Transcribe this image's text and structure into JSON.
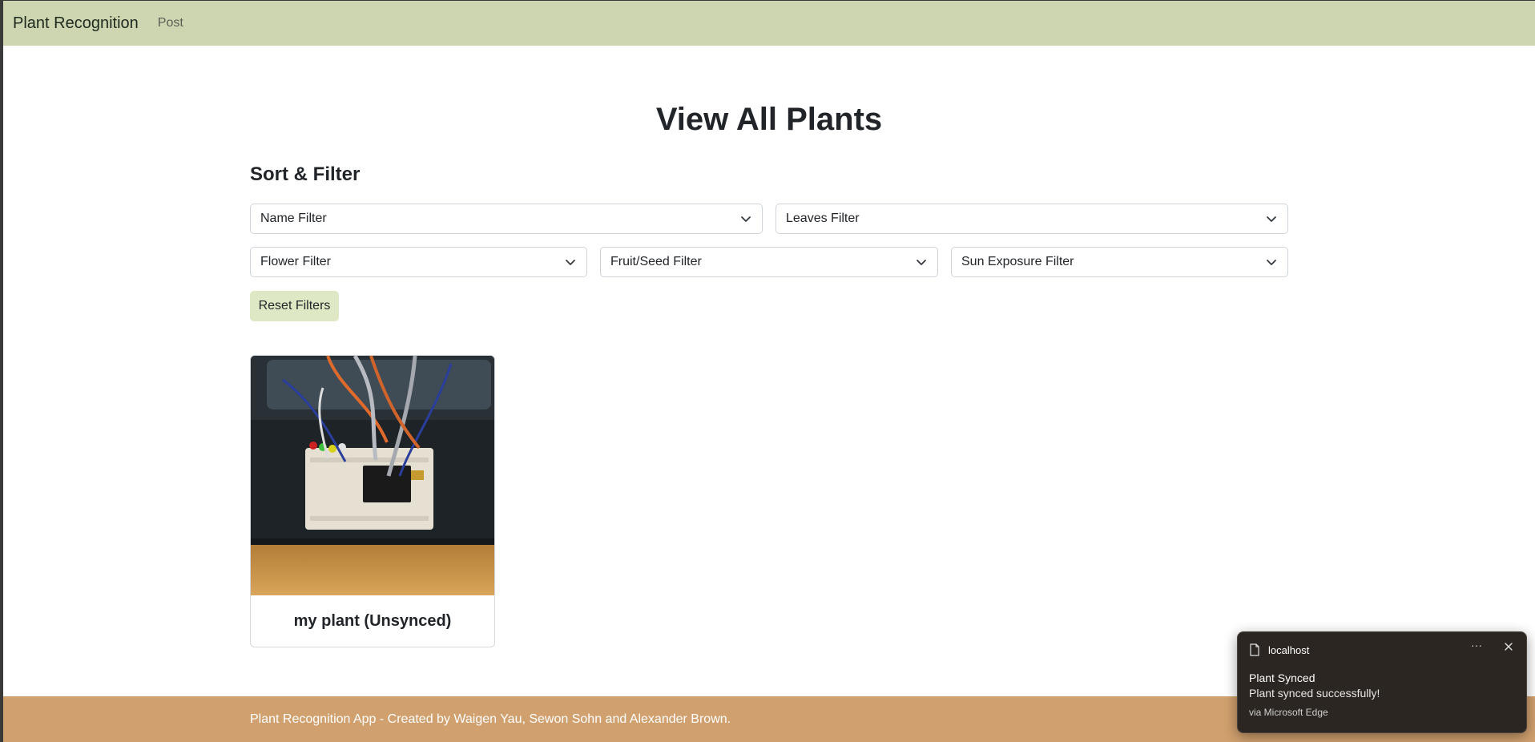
{
  "navbar": {
    "brand": "Plant Recognition",
    "post_link": "Post"
  },
  "page": {
    "title": "View All Plants"
  },
  "filters": {
    "section_title": "Sort & Filter",
    "name": "Name Filter",
    "leaves": "Leaves Filter",
    "flower": "Flower Filter",
    "fruit_seed": "Fruit/Seed Filter",
    "sun_exposure": "Sun Exposure Filter",
    "reset_label": "Reset Filters"
  },
  "plants": [
    {
      "title": "my plant (Unsynced)"
    }
  ],
  "footer": {
    "text": "Plant Recognition App - Created by Waigen Yau, Sewon Sohn and Alexander Brown."
  },
  "notification": {
    "source": "localhost",
    "more": "···",
    "title": "Plant Synced",
    "message": "Plant synced successfully!",
    "via": "via Microsoft Edge"
  },
  "colors": {
    "navbar": "#cdd6b1",
    "reset_button": "#dfe8c4",
    "footer": "#d0a06e",
    "toast": "#2b2621"
  },
  "icons": {
    "select_arrow": "chevron-down-icon",
    "toast_file": "file-icon",
    "toast_close": "close-icon"
  }
}
